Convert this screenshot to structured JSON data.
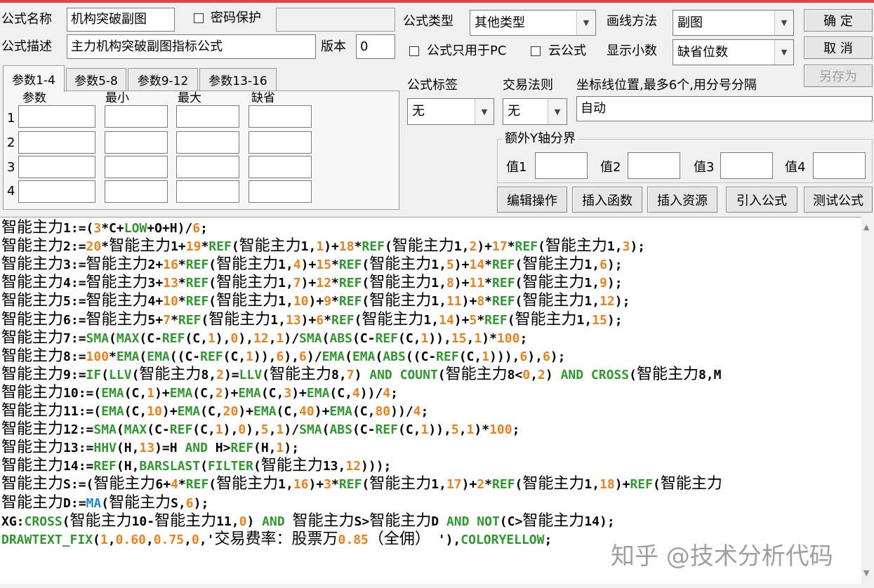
{
  "form": {
    "name_label": "公式名称",
    "name_value": "机构突破副图",
    "password_label": "密码保护",
    "desc_label": "公式描述",
    "desc_value": "主力机构突破副图指标公式",
    "version_label": "版本",
    "version_value": "0",
    "type_label": "公式类型",
    "type_value": "其他类型",
    "draw_label": "画线方法",
    "draw_value": "副图",
    "pc_only_label": "公式只用于PC",
    "cloud_label": "云公式",
    "decimal_label": "显示小数",
    "decimal_value": "缺省位数",
    "tag_label": "公式标签",
    "tag_value": "无",
    "rule_label": "交易法则",
    "rule_value": "无",
    "coord_label": "坐标线位置,最多6个,用分号分隔",
    "coord_value": "自动",
    "extra_y_label": "额外Y轴分界",
    "y_values": [
      "值1",
      "值2",
      "值3",
      "值4"
    ]
  },
  "buttons": {
    "ok": "确  定",
    "cancel": "取  消",
    "save_as": "另存为",
    "edit": "编辑操作",
    "insert_func": "插入函数",
    "insert_res": "插入资源",
    "import": "引入公式",
    "test": "测试公式"
  },
  "params": {
    "tabs": [
      "参数1-4",
      "参数5-8",
      "参数9-12",
      "参数13-16"
    ],
    "headers": [
      "参数",
      "最小",
      "最大",
      "缺省"
    ],
    "rows": [
      "1",
      "2",
      "3",
      "4"
    ]
  },
  "code": [
    "智能主力1:=(3*C+LOW+O+H)/6;",
    "智能主力2:=20*智能主力1+19*REF(智能主力1,1)+18*REF(智能主力1,2)+17*REF(智能主力1,3);",
    "智能主力3:=智能主力2+16*REF(智能主力1,4)+15*REF(智能主力1,5)+14*REF(智能主力1,6);",
    "智能主力4:=智能主力3+13*REF(智能主力1,7)+12*REF(智能主力1,8)+11*REF(智能主力1,9);",
    "智能主力5:=智能主力4+10*REF(智能主力1,10)+9*REF(智能主力1,11)+8*REF(智能主力1,12);",
    "智能主力6:=智能主力5+7*REF(智能主力1,13)+6*REF(智能主力1,14)+5*REF(智能主力1,15);",
    "智能主力7:=SMA(MAX(C-REF(C,1),0),12,1)/SMA(ABS(C-REF(C,1)),15,1)*100;",
    "智能主力8:=100*EMA(EMA((C-REF(C,1)),6),6)/EMA(EMA(ABS((C-REF(C,1))),6),6);",
    "智能主力9:=IF(LLV(智能主力8,2)=LLV(智能主力8,7) AND COUNT(智能主力8<0,2) AND CROSS(智能主力8,M",
    "智能主力10:=(EMA(C,1)+EMA(C,2)+EMA(C,3)+EMA(C,4))/4;",
    "智能主力11:=(EMA(C,10)+EMA(C,20)+EMA(C,40)+EMA(C,80))/4;",
    "智能主力12:=SMA(MAX(C-REF(C,1),0),5,1)/SMA(ABS(C-REF(C,1)),5,1)*100;",
    "智能主力13:=HHV(H,13)=H AND H>REF(H,1);",
    "智能主力14:=REF(H,BARSLAST(FILTER(智能主力13,12)));",
    "智能主力S:=(智能主力6+4*REF(智能主力1,16)+3*REF(智能主力1,17)+2*REF(智能主力1,18)+REF(智能主力",
    "智能主力D:=MA(智能主力S,6);",
    "XG:CROSS(智能主力10-智能主力11,0) AND 智能主力S>智能主力D AND NOT(C>智能主力14);",
    "DRAWTEXT_FIX(1,0.60,0.75,0,'交易费率：股票万0.85（全佣） '),COLORYELLOW;"
  ],
  "watermark": "知乎 @技术分析代码",
  "colors": {
    "function": "#2e9a2e",
    "number": "#f08018",
    "ma_func": "#1e88d8",
    "yellow": "#c8b800",
    "top_accent": "#d84848"
  }
}
